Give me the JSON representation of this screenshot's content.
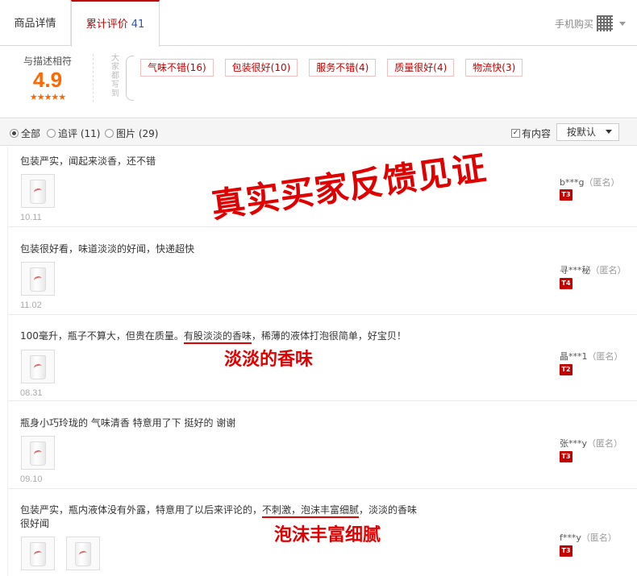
{
  "tabs": {
    "detail": "商品详情",
    "review": "累计评价",
    "review_count": "41",
    "mobile_buy": "手机购买"
  },
  "summary": {
    "label": "与描述相符",
    "score": "4.9",
    "stars": "★★★★★",
    "vertical_text": "大家都写到",
    "tags": [
      "气味不错(16)",
      "包装很好(10)",
      "服务不错(4)",
      "质量很好(4)",
      "物流快(3)"
    ]
  },
  "filters": {
    "all": "全部",
    "append": "追评 (11)",
    "photo": "图片 (29)",
    "has_content": "有内容",
    "sort": "按默认"
  },
  "reviews": [
    {
      "text": "包装严实，闻起来淡香，还不错",
      "date": "10.11",
      "user": "b***g",
      "anon": "（匿名）",
      "level": "T3"
    },
    {
      "text": "包装很好看，味道淡淡的好闻，快递超快",
      "date": "11.02",
      "user": "寻***秘",
      "anon": "（匿名）",
      "level": "T4"
    },
    {
      "text_a": "100毫升，瓶子不算大，但贵在质量。",
      "text_b": "有股淡淡的香味",
      "text_c": "，稀薄的液体打泡很简单，好宝贝！",
      "date": "08.31",
      "user": "晶***1",
      "anon": "（匿名）",
      "level": "T2"
    },
    {
      "text": "瓶身小巧玲珑的 气味清香 特意用了下 挺好的 谢谢",
      "date": "09.10",
      "user": "张***y",
      "anon": "（匿名）",
      "level": "T3"
    },
    {
      "text_a": "包装严实，瓶内液体没有外露，特意用了以后来评论的，",
      "text_b": "不刺激，泡沫丰富细腻",
      "text_c": "，淡淡的香味",
      "text_d": "很好闻",
      "user": "f***y",
      "anon": "（匿名）",
      "level": "T3"
    }
  ],
  "overlays": {
    "big": "真实买家反馈见证",
    "note1": "淡淡的香味",
    "note2": "泡沫丰富细腻"
  }
}
